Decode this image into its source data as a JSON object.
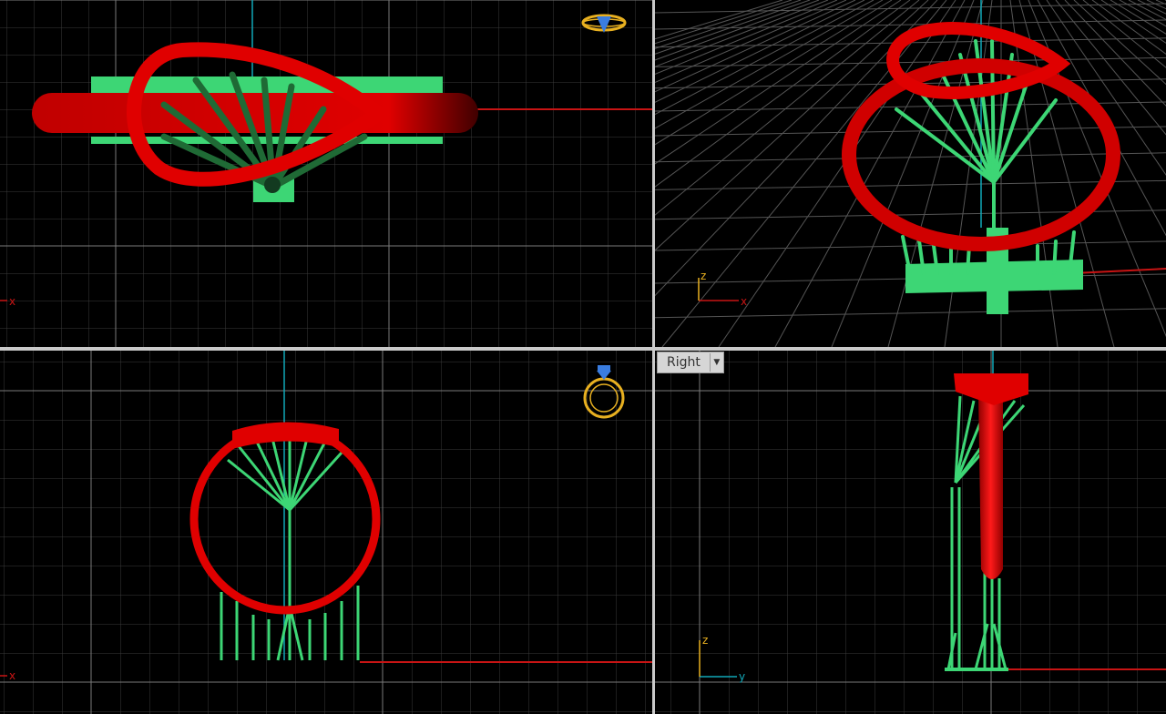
{
  "viewports": {
    "top": {
      "axis_x_label": "x"
    },
    "perspective": {
      "axis_x_label": "x",
      "axis_z_label": "z"
    },
    "front": {
      "axis_x_label": "x"
    },
    "right": {
      "name": "Right",
      "dropdown_icon": "chevron-down-icon",
      "axis_y_label": "y",
      "axis_z_label": "z"
    }
  },
  "colors": {
    "background": "#000000",
    "grid_minor": "#3a3a3a",
    "grid_major": "#7a7a7a",
    "axis_x": "#c81414",
    "axis_y": "#11a8b8",
    "ring": "#e00000",
    "supports": "#3dd675",
    "gizmo": "#e8b020",
    "gem": "#3a7de0"
  }
}
